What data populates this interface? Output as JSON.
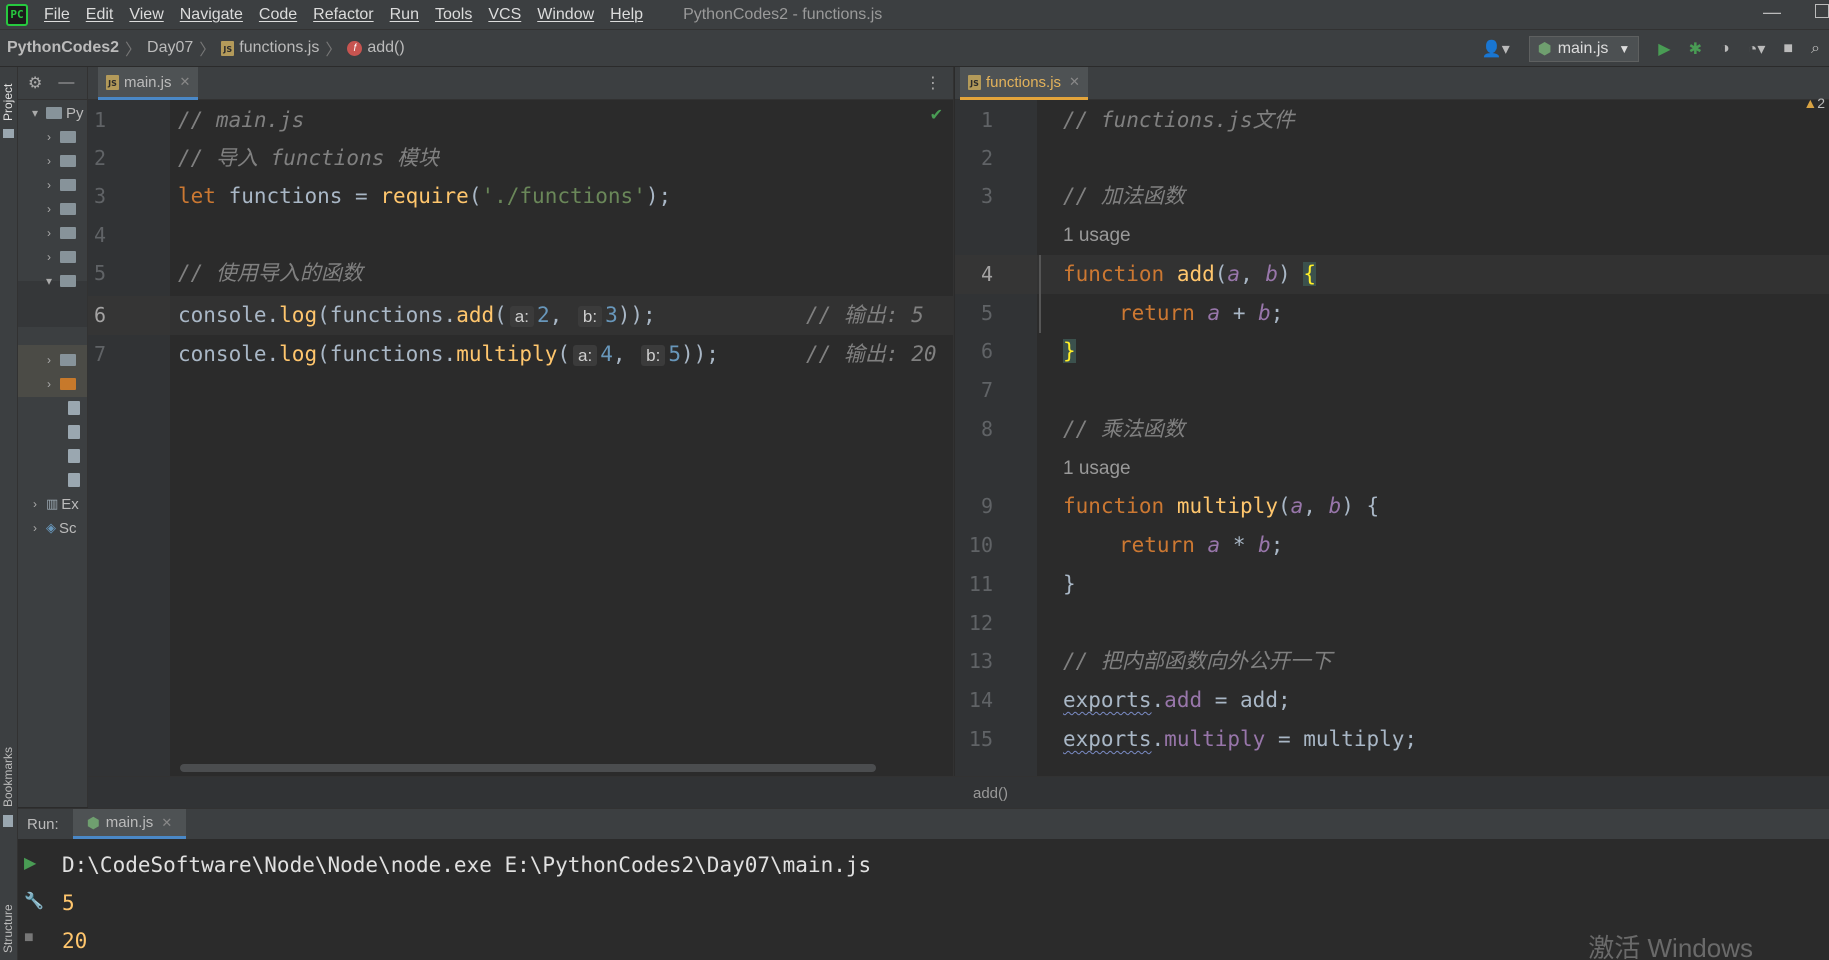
{
  "menubar": {
    "items": [
      "File",
      "Edit",
      "View",
      "Navigate",
      "Code",
      "Refactor",
      "Run",
      "Tools",
      "VCS",
      "Window",
      "Help"
    ],
    "title": "PythonCodes2 - functions.js"
  },
  "navbar": {
    "project": "PythonCodes2",
    "folder": "Day07",
    "file": "functions.js",
    "symbol": "add()",
    "run_config": "main.js"
  },
  "stripe": {
    "project": "Project",
    "bookmarks": "Bookmarks",
    "structure": "Structure"
  },
  "project_panel": {
    "rows": [
      "Py",
      "Ex",
      "Sc"
    ]
  },
  "left_editor": {
    "tab": "main.js",
    "line_numbers": [
      "1",
      "2",
      "3",
      "4",
      "5",
      "6",
      "7"
    ],
    "l1": "// main.js",
    "l2": "// 导入 functions 模块",
    "l3_kw": "let",
    "l3_var": " functions = ",
    "l3_fn": "require",
    "l3_str": "'./functions'",
    "l5": "// 使用导入的函数",
    "l6_console": "console.",
    "l6_log": "log",
    "l6_obj": "functions.",
    "l6_method": "add",
    "l6_hint_a": "a:",
    "l6_val_a": "2",
    "l6_hint_b": "b:",
    "l6_val_b": "3",
    "l6_comment": "// 输出: 5",
    "l7_console": "console.",
    "l7_log": "log",
    "l7_obj": "functions.",
    "l7_method": "multiply",
    "l7_hint_a": "a:",
    "l7_val_a": "4",
    "l7_hint_b": "b:",
    "l7_val_b": "5",
    "l7_comment": "// 输出: 20"
  },
  "right_editor": {
    "tab": "functions.js",
    "warnings": "2",
    "line_numbers": [
      "1",
      "2",
      "3",
      "4",
      "5",
      "6",
      "7",
      "8",
      "9",
      "10",
      "11",
      "12",
      "13",
      "14",
      "15"
    ],
    "l1": "// functions.js文件",
    "l3": "// 加法函数",
    "usage1": "1 usage",
    "l4_kw": "function",
    "l4_name": "add",
    "l4_a": "a",
    "l4_b": "b",
    "l5_kw": "return",
    "l5_a": "a",
    "l5_op": " + ",
    "l5_b": "b",
    "l8": "// 乘法函数",
    "usage2": "1 usage",
    "l9_kw": "function",
    "l9_name": "multiply",
    "l9_a": "a",
    "l9_b": "b",
    "l10_kw": "return",
    "l10_a": "a",
    "l10_op": " * ",
    "l10_b": "b",
    "l13": "// 把内部函数向外公开一下",
    "l14_exports": "exports",
    "l14_prop": "add",
    "l14_rest": " = add;",
    "l15_exports": "exports",
    "l15_prop": "multiply",
    "l15_rest": " = multiply;",
    "status_symbol": "add()"
  },
  "run_panel": {
    "label": "Run:",
    "tab": "main.js",
    "command": "D:\\CodeSoftware\\Node\\Node\\node.exe E:\\PythonCodes2\\Day07\\main.js",
    "out1": "5",
    "out2": "20"
  },
  "watermark": "激活 Windows",
  "colors": {
    "accent_tab": "#4a88c7",
    "active_file_tab": "#e3a43b",
    "run_green": "#499c54"
  }
}
